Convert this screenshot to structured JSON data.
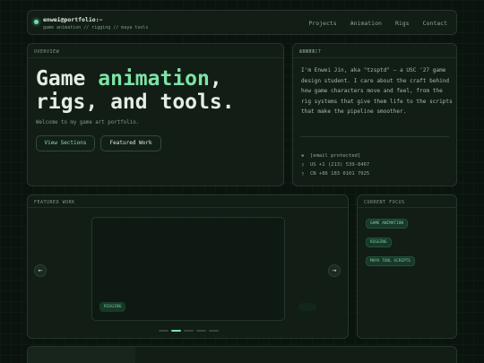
{
  "header": {
    "title": "enwei@portfolio:~",
    "subtitle": "game animation // rigging // maya tools",
    "nav": [
      "Projects",
      "Animation",
      "Rigs",
      "Contact"
    ]
  },
  "hero": {
    "label": "OVERVIEW",
    "line1_pre": "Game ",
    "line1_accent": "animation",
    "line1_post": ",",
    "line2": "rigs, and tools.",
    "welcome": "Welcome to my game art portfolio.",
    "primary_button": "View Sections",
    "secondary_button": "Featured Work"
  },
  "about": {
    "label": "ABOUT",
    "text": "I'm Enwei Jin, aka \"tzsptd\" — a USC '27 game design student. I care about the craft behind how game characters move and feel, from the rig systems that give them life to the scripts that make the pipeline smoother.",
    "contact_label": "CONTACT",
    "contacts": [
      {
        "icon": "mail-icon",
        "glyph": "▪",
        "text": "[email protected]"
      },
      {
        "icon": "phone-icon",
        "glyph": "▯",
        "text": "US  +1 (213) 539-8467"
      },
      {
        "icon": "phone-icon",
        "glyph": "▯",
        "text": "CN  +86 183 0101 7925"
      }
    ]
  },
  "featured": {
    "label": "FEATURED WORK",
    "tag": "RIGGING",
    "prev": "←",
    "next": "→",
    "slide_count": 5,
    "active_slide": 2
  },
  "focus": {
    "label": "CURRENT FOCUS",
    "items": [
      "GAME ANIMATION",
      "RIGGING",
      "MAYA TOOL SCRIPTS"
    ]
  },
  "colors": {
    "accent": "#7ee3a6",
    "background": "#0b130e",
    "panel": "#121e16"
  }
}
